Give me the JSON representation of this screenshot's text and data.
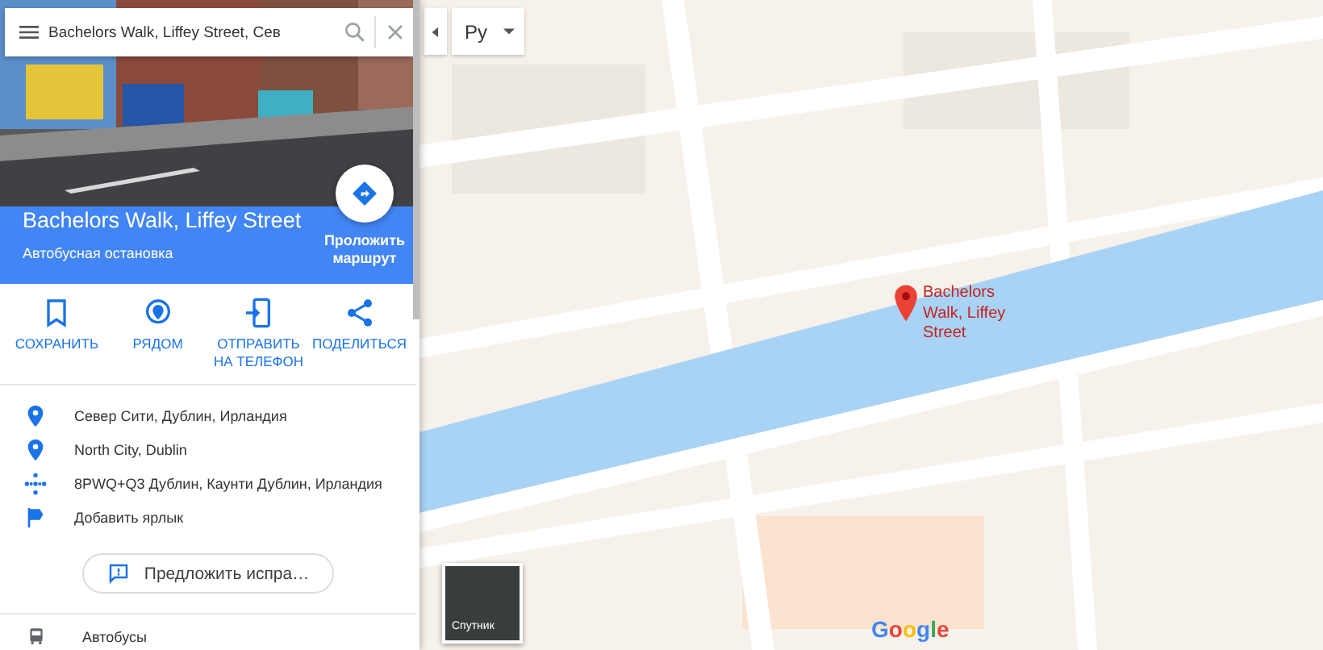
{
  "search": {
    "value": "Bachelors Walk, Liffey Street, Сев"
  },
  "place": {
    "title": "Bachelors Walk, Liffey Street",
    "category": "Автобусная остановка",
    "directions_label": "Проложить маршрут"
  },
  "actions": [
    {
      "kind": "save",
      "label": "СОХРАНИТЬ"
    },
    {
      "kind": "nearby",
      "label": "РЯДОМ"
    },
    {
      "kind": "send",
      "label": "ОТПРАВИТЬ НА ТЕЛЕФОН"
    },
    {
      "kind": "share",
      "label": "ПОДЕЛИТЬСЯ"
    }
  ],
  "details": [
    {
      "kind": "address",
      "text": "Север Сити, Дублин, Ирландия"
    },
    {
      "kind": "address",
      "text": "North City, Dublin"
    },
    {
      "kind": "plus_code",
      "text": "8PWQ+Q3 Дублин, Каунти Дублин, Ирландия"
    },
    {
      "kind": "label",
      "text": "Добавить ярлык"
    }
  ],
  "suggest_edit": "Предложить испра…",
  "transit": {
    "label": "Автобусы"
  },
  "map": {
    "language": "Ру",
    "marker": "Bachelors Walk, Liffey Street",
    "layer": "Спутник",
    "logo": "Google"
  }
}
